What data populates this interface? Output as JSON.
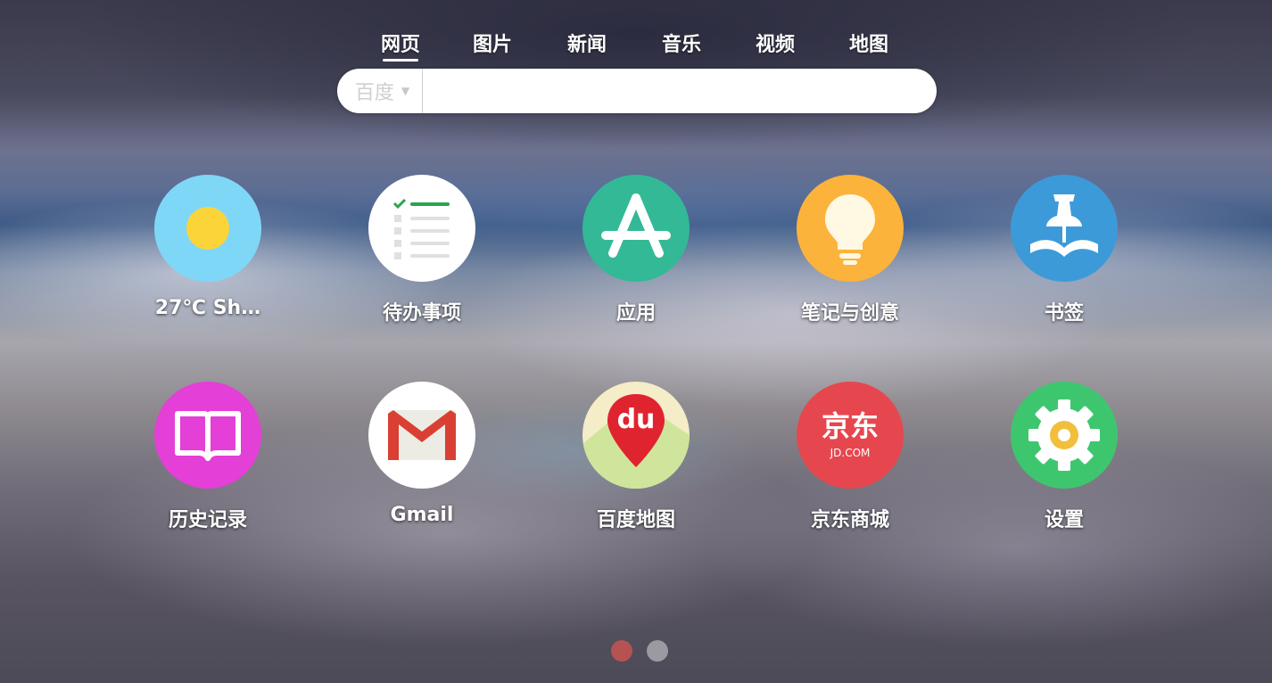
{
  "nav": {
    "tabs": [
      {
        "label": "网页",
        "active": true
      },
      {
        "label": "图片",
        "active": false
      },
      {
        "label": "新闻",
        "active": false
      },
      {
        "label": "音乐",
        "active": false
      },
      {
        "label": "视频",
        "active": false
      },
      {
        "label": "地图",
        "active": false
      }
    ]
  },
  "search": {
    "engine": "百度",
    "query": "",
    "placeholder": ""
  },
  "apps": [
    {
      "label": "27℃ Sh…",
      "icon": "weather-sunny-icon",
      "color": "#7fd7f7"
    },
    {
      "label": "待办事项",
      "icon": "todo-list-icon",
      "color": "#ffffff"
    },
    {
      "label": "应用",
      "icon": "app-store-icon",
      "color": "#33b996"
    },
    {
      "label": "笔记与创意",
      "icon": "lightbulb-icon",
      "color": "#fcb33b"
    },
    {
      "label": "书签",
      "icon": "pushpin-bookmark-icon",
      "color": "#3d9ad9"
    },
    {
      "label": "历史记录",
      "icon": "open-book-icon",
      "color": "#e43fd6"
    },
    {
      "label": "Gmail",
      "icon": "gmail-icon",
      "color": "#ffffff"
    },
    {
      "label": "百度地图",
      "icon": "baidu-map-icon",
      "color": "#f5ecc8"
    },
    {
      "label": "京东商城",
      "icon": "jd-icon",
      "color": "#e6474e",
      "icon_text": "京东",
      "icon_subtext": "JD.COM"
    },
    {
      "label": "设置",
      "icon": "gear-icon",
      "color": "#3ec66f"
    }
  ],
  "pager": {
    "pages": 2,
    "current": 1,
    "colors": {
      "active": "#b55252",
      "inactive": "#9a9aa0"
    }
  }
}
